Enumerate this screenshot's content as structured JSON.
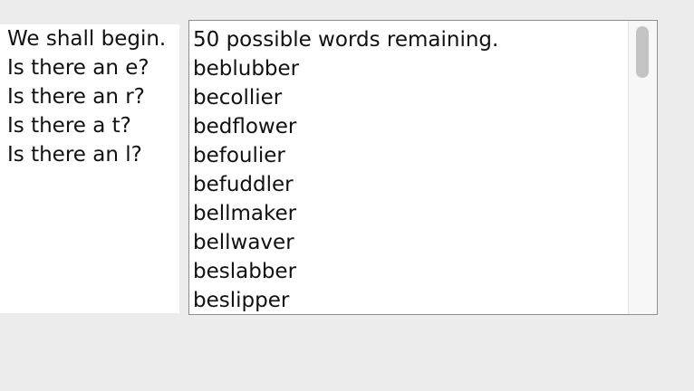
{
  "questions": [
    "We shall begin.",
    "Is there an e?",
    "Is there an r?",
    "Is there a t?",
    "Is there an l?"
  ],
  "word_list": {
    "status": "50 possible words remaining.",
    "words": [
      "beblubber",
      "becollier",
      "bedflower",
      "befoulier",
      "befuddler",
      "bellmaker",
      "bellwaver",
      "beslabber",
      "beslipper"
    ]
  },
  "scrollbar": {
    "position_fraction": 0.0
  }
}
